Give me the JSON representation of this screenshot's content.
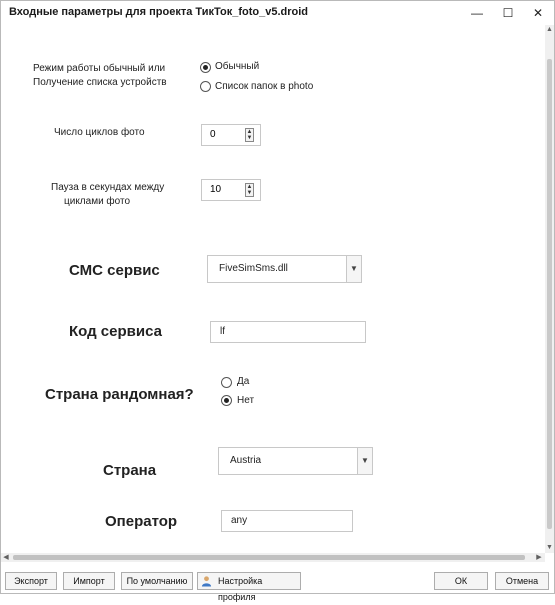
{
  "window": {
    "title": "Входные параметры для проекта ТикТок_foto_v5.droid",
    "minimize_glyph": "—",
    "maximize_glyph": "☐",
    "close_glyph": "✕"
  },
  "params": {
    "mode": {
      "label_line1": "Режим работы обычный или",
      "label_line2": "Получение списка устройств",
      "options": [
        {
          "label": "Обычный",
          "checked": true
        },
        {
          "label": "Список папок в photo",
          "checked": false
        }
      ]
    },
    "cycles": {
      "label": "Число циклов фото",
      "value": "0"
    },
    "pause": {
      "label_line1": "Пауза в секундах между",
      "label_line2": "циклами фото",
      "value": "10"
    },
    "sms_service": {
      "label": "СМС сервис",
      "value": "FiveSimSms.dll"
    },
    "service_code": {
      "label": "Код сервиса",
      "value": "lf"
    },
    "random_country": {
      "label": "Страна рандомная?",
      "options": [
        {
          "label": "Да",
          "checked": false
        },
        {
          "label": "Нет",
          "checked": true
        }
      ]
    },
    "country": {
      "label": "Страна",
      "value": "Austria"
    },
    "operator": {
      "label": "Оператор",
      "value": "any"
    }
  },
  "footer": {
    "export": "Экспорт",
    "import": "Импорт",
    "defaults": "По умолчанию",
    "profile_settings": "Настройка профиля",
    "ok": "ОК",
    "cancel": "Отмена"
  },
  "icons": {
    "profile": "person-icon",
    "dropdown": "chevron-down-icon"
  }
}
